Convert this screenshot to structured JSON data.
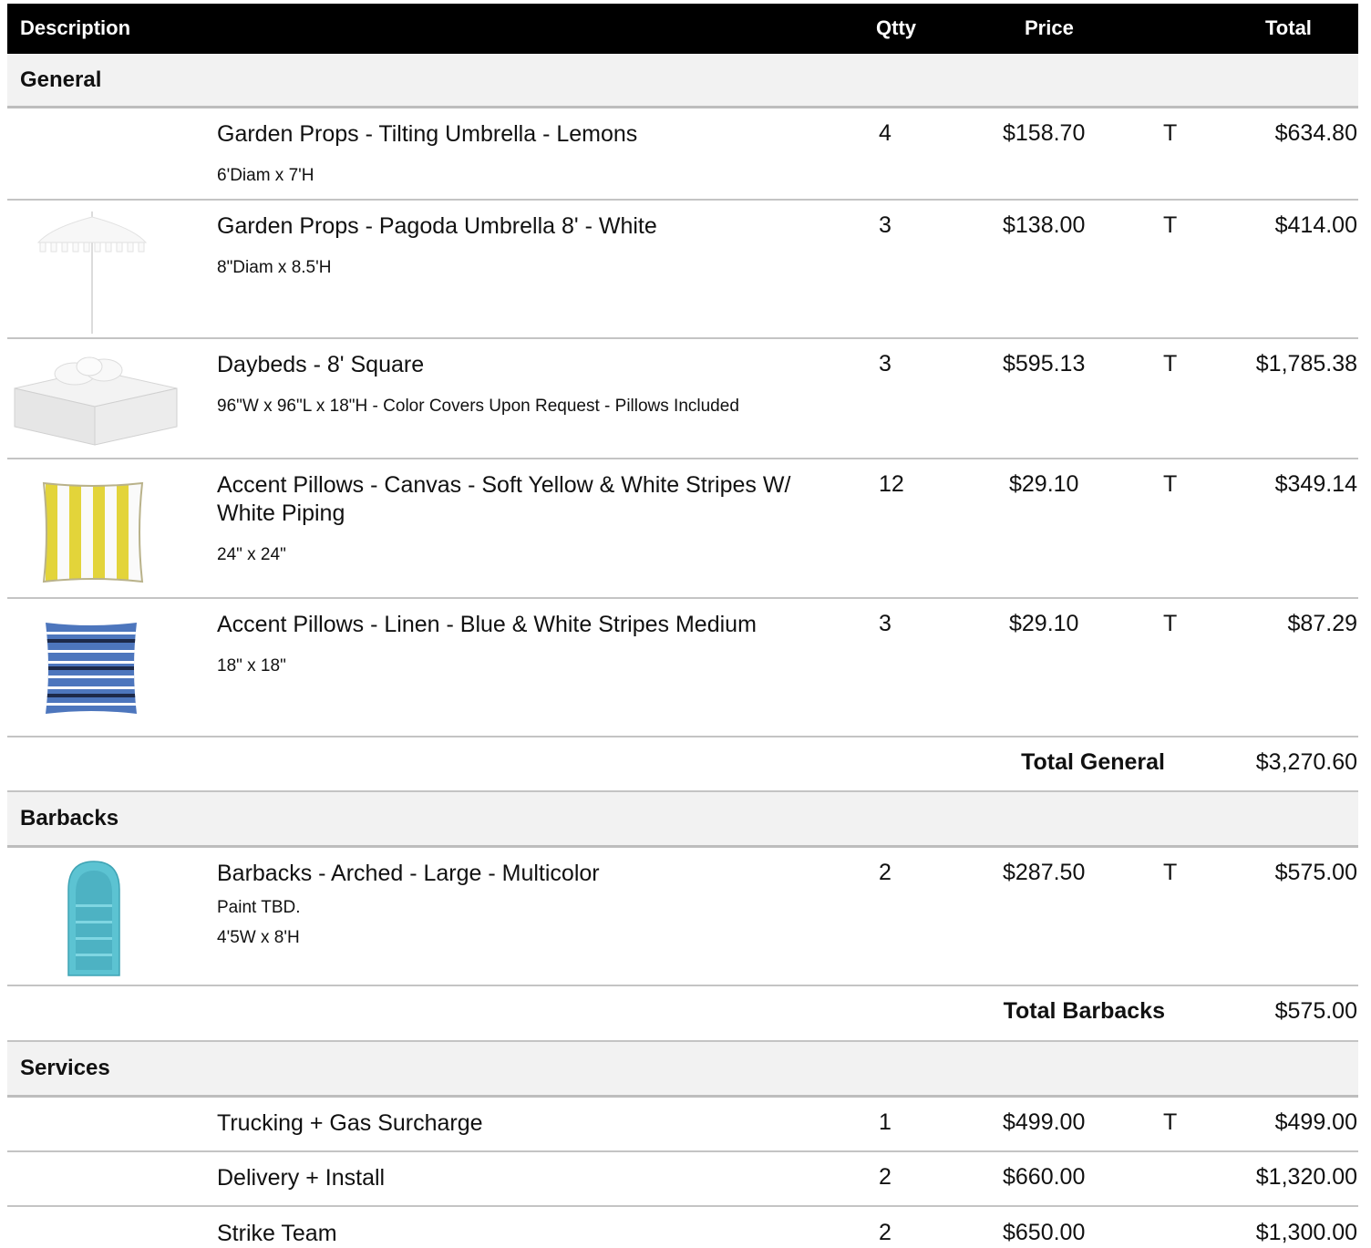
{
  "header": {
    "description": "Description",
    "qty": "Qtty",
    "price": "Price",
    "total": "Total"
  },
  "sections": {
    "general": {
      "title": "General",
      "items": [
        {
          "name": "Garden Props - Tilting Umbrella - Lemons",
          "details": [
            "6'Diam x 7'H"
          ],
          "qty": "4",
          "price": "$158.70",
          "tax": "T",
          "total": "$634.80",
          "image": "none"
        },
        {
          "name": "Garden Props - Pagoda Umbrella 8' - White",
          "details": [
            "8\"Diam x 8.5'H"
          ],
          "qty": "3",
          "price": "$138.00",
          "tax": "T",
          "total": "$414.00",
          "image": "white-pagoda-umbrella"
        },
        {
          "name": "Daybeds - 8' Square",
          "details": [
            "96\"W x 96\"L x 18\"H - Color Covers Upon Request - Pillows Included"
          ],
          "qty": "3",
          "price": "$595.13",
          "tax": "T",
          "total": "$1,785.38",
          "image": "white-square-daybed"
        },
        {
          "name": "Accent Pillows - Canvas - Soft Yellow & White Stripes W/ White Piping",
          "details": [
            "24\" x 24\""
          ],
          "qty": "12",
          "price": "$29.10",
          "tax": "T",
          "total": "$349.14",
          "image": "yellow-striped-pillow"
        },
        {
          "name": "Accent Pillows - Linen - Blue & White Stripes Medium",
          "details": [
            "18\" x 18\""
          ],
          "qty": "3",
          "price": "$29.10",
          "tax": "T",
          "total": "$87.29",
          "image": "blue-striped-pillow"
        }
      ],
      "total_label": "Total General",
      "total_value": "$3,270.60"
    },
    "barbacks": {
      "title": "Barbacks",
      "items": [
        {
          "name": "Barbacks - Arched - Large - Multicolor",
          "details": [
            "Paint TBD.",
            "4'5W x 8'H"
          ],
          "qty": "2",
          "price": "$287.50",
          "tax": "T",
          "total": "$575.00",
          "image": "turquoise-arched-shelf"
        }
      ],
      "total_label": "Total Barbacks",
      "total_value": "$575.00"
    },
    "services": {
      "title": "Services",
      "items": [
        {
          "name": "Trucking + Gas Surcharge",
          "qty": "1",
          "price": "$499.00",
          "tax": "T",
          "total": "$499.00"
        },
        {
          "name": "Delivery + Install",
          "qty": "2",
          "price": "$660.00",
          "tax": "",
          "total": "$1,320.00"
        },
        {
          "name": "Strike Team",
          "qty": "2",
          "price": "$650.00",
          "tax": "",
          "total": "$1,300.00"
        }
      ]
    }
  },
  "colors": {
    "header_bg": "#000000",
    "section_bg": "#f2f2f2",
    "row_divider": "#c4c4c4",
    "pillow_yellow": "#e3d43a",
    "pillow_blue": "#4d76bd",
    "barback_turquoise": "#5cc3d2"
  }
}
